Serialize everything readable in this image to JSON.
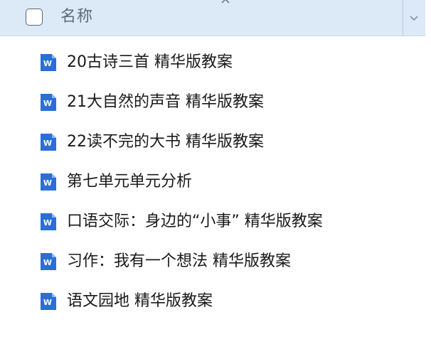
{
  "header": {
    "column_label": "名称"
  },
  "icons": {
    "checkbox": "checkbox-unchecked",
    "close": "close-x-icon",
    "dropdown": "chevron-down-icon",
    "file": "word-document-icon"
  },
  "colors": {
    "header_bg": "#dce9f7",
    "word_blue": "#2b6ed6"
  },
  "files": [
    {
      "name": "20古诗三首 精华版教案"
    },
    {
      "name": "21大自然的声音 精华版教案"
    },
    {
      "name": "22读不完的大书 精华版教案"
    },
    {
      "name": "第七单元单元分析"
    },
    {
      "name": "口语交际：身边的“小事” 精华版教案"
    },
    {
      "name": "习作：我有一个想法 精华版教案"
    },
    {
      "name": "语文园地 精华版教案"
    }
  ]
}
